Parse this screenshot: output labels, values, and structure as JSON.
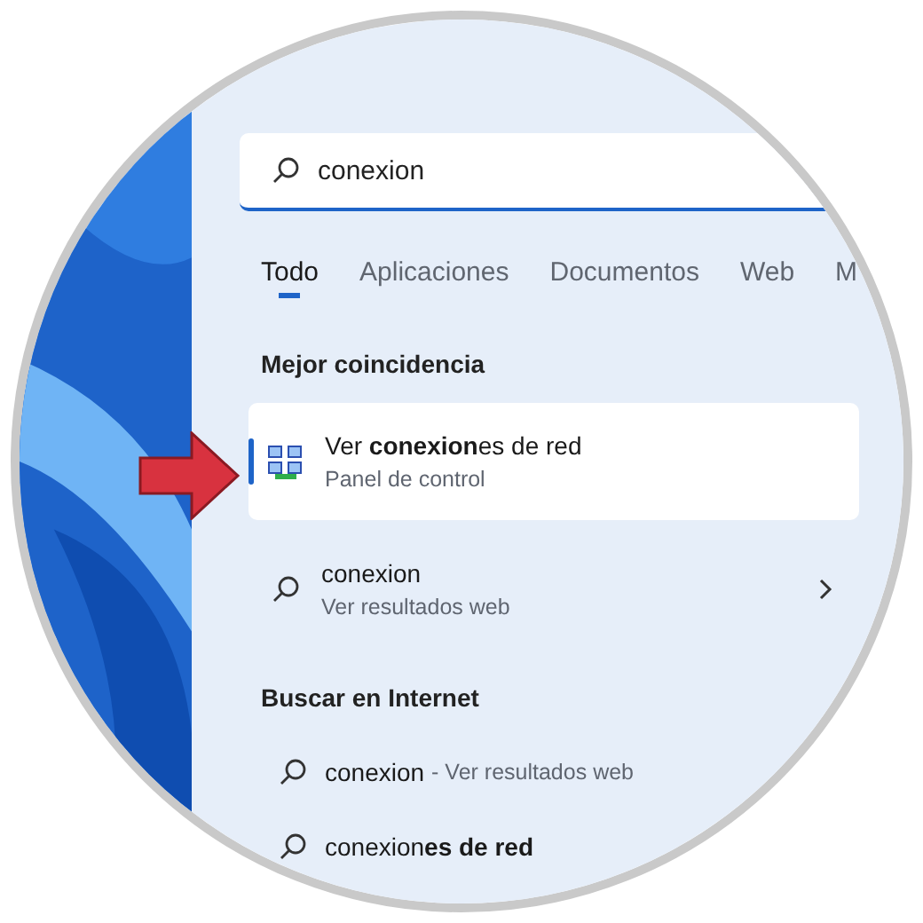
{
  "search": {
    "value": "conexion"
  },
  "tabs": [
    {
      "label": "Todo",
      "selected": true
    },
    {
      "label": "Aplicaciones",
      "selected": false
    },
    {
      "label": "Documentos",
      "selected": false
    },
    {
      "label": "Web",
      "selected": false
    },
    {
      "label": "M",
      "selected": false
    }
  ],
  "best_match": {
    "heading": "Mejor coincidencia",
    "title": "Ver **conexion**es de red",
    "subtitle": "Panel de control",
    "selected": true
  },
  "web_result": {
    "title": "conexion",
    "subtitle": "Ver resultados web"
  },
  "internet": {
    "heading": "Buscar en Internet",
    "items": [
      {
        "query": "conexion",
        "suffix": "- Ver resultados web"
      },
      {
        "query": "conexion**es de red**"
      }
    ]
  }
}
